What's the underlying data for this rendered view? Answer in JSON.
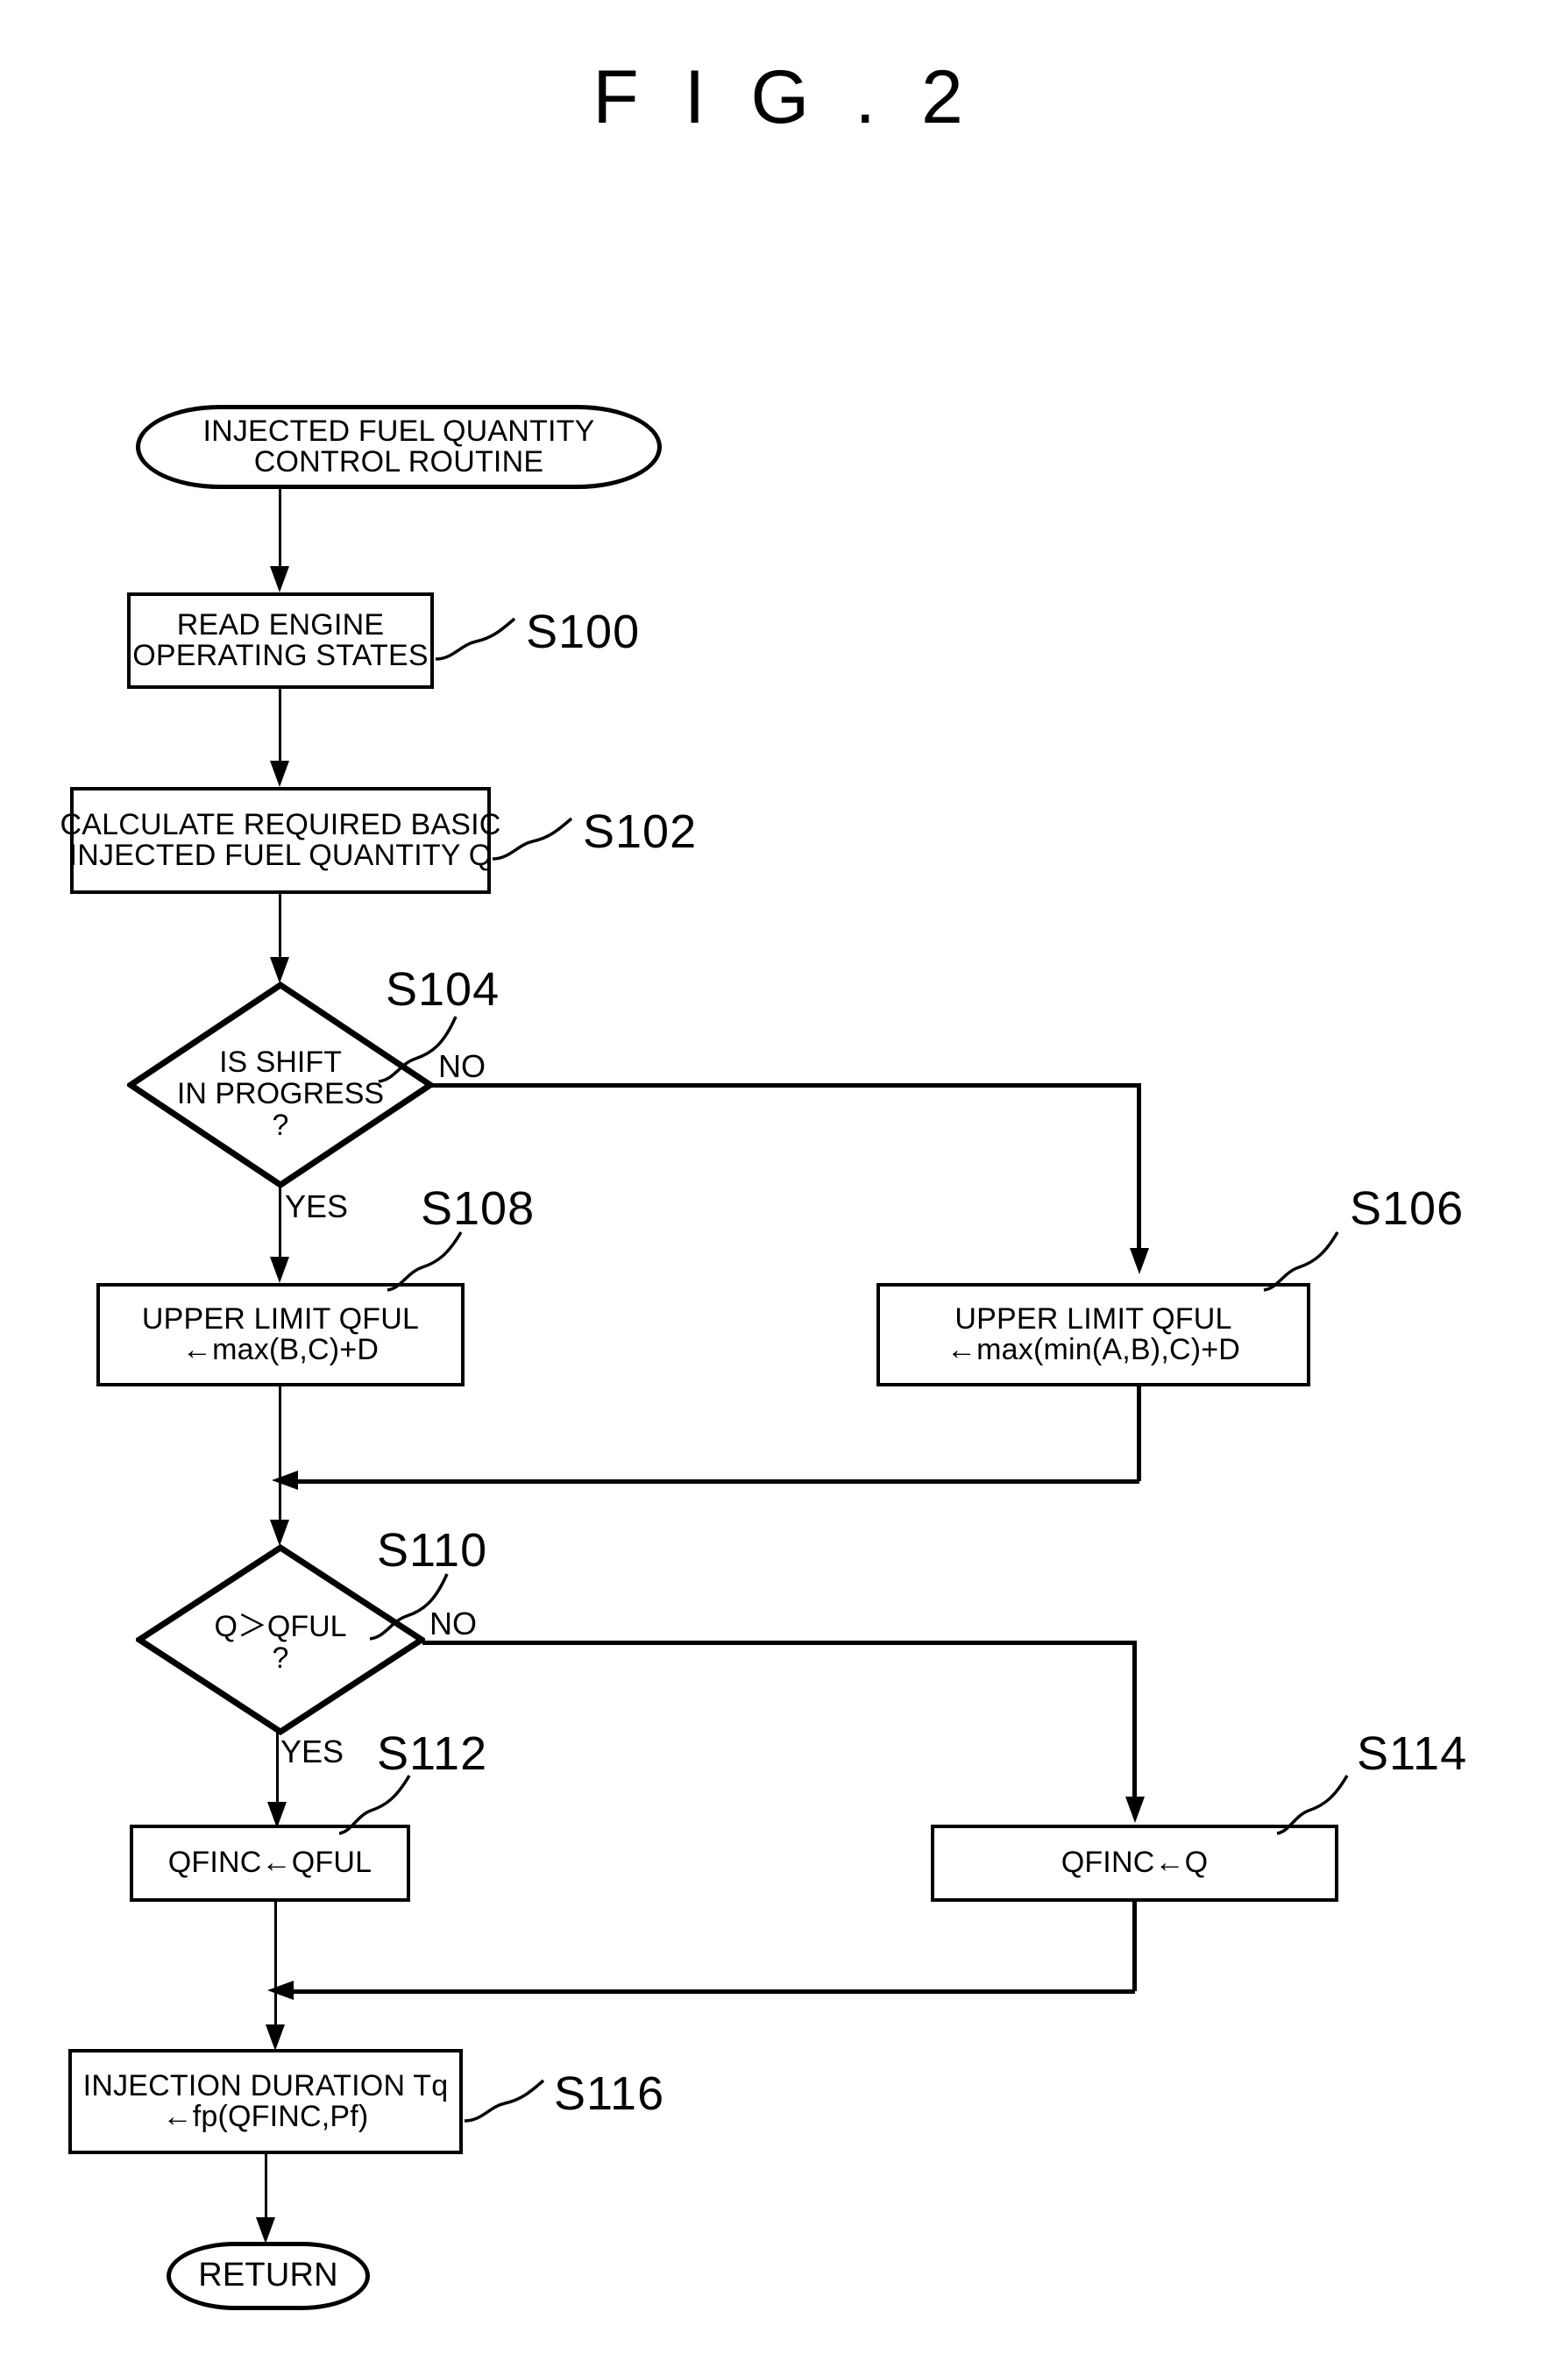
{
  "figure": {
    "title": "F I G . 2"
  },
  "flowchart": {
    "type": "flowchart",
    "orientation": "top-to-bottom",
    "nodes": [
      {
        "id": "start",
        "shape": "terminator",
        "step": "",
        "lines": [
          "INJECTED FUEL QUANTITY",
          "CONTROL ROUTINE"
        ]
      },
      {
        "id": "s100",
        "shape": "process",
        "step": "S100",
        "lines": [
          "READ ENGINE",
          "OPERATING STATES"
        ]
      },
      {
        "id": "s102",
        "shape": "process",
        "step": "S102",
        "lines": [
          "CALCULATE REQUIRED BASIC",
          "INJECTED FUEL QUANTITY Q"
        ]
      },
      {
        "id": "s104",
        "shape": "decision",
        "step": "S104",
        "lines": [
          "IS SHIFT",
          "IN PROGRESS",
          "?"
        ],
        "yes_label": "YES",
        "no_label": "NO"
      },
      {
        "id": "s108",
        "shape": "process",
        "step": "S108",
        "lines": [
          "UPPER LIMIT QFUL",
          "←max(B,C)+D"
        ]
      },
      {
        "id": "s106",
        "shape": "process",
        "step": "S106",
        "lines": [
          "UPPER LIMIT QFUL",
          "←max(min(A,B),C)+D"
        ]
      },
      {
        "id": "s110",
        "shape": "decision",
        "step": "S110",
        "lines": [
          "Q＞QFUL",
          "?"
        ],
        "yes_label": "YES",
        "no_label": "NO"
      },
      {
        "id": "s112",
        "shape": "process",
        "step": "S112",
        "lines": [
          "QFINC←QFUL"
        ]
      },
      {
        "id": "s114",
        "shape": "process",
        "step": "S114",
        "lines": [
          "QFINC←Q"
        ]
      },
      {
        "id": "s116",
        "shape": "process",
        "step": "S116",
        "lines": [
          "INJECTION DURATION Tq",
          "←fp(QFINC,Pf)"
        ]
      },
      {
        "id": "return",
        "shape": "terminator",
        "step": "",
        "lines": [
          "RETURN"
        ]
      }
    ],
    "edges": [
      {
        "from": "start",
        "to": "s100",
        "label": ""
      },
      {
        "from": "s100",
        "to": "s102",
        "label": ""
      },
      {
        "from": "s102",
        "to": "s104",
        "label": ""
      },
      {
        "from": "s104",
        "to": "s108",
        "label": "YES"
      },
      {
        "from": "s104",
        "to": "s106",
        "label": "NO"
      },
      {
        "from": "s108",
        "to": "s110",
        "label": ""
      },
      {
        "from": "s106",
        "to": "s110",
        "label": ""
      },
      {
        "from": "s110",
        "to": "s112",
        "label": "YES"
      },
      {
        "from": "s110",
        "to": "s114",
        "label": "NO"
      },
      {
        "from": "s112",
        "to": "s116",
        "label": ""
      },
      {
        "from": "s114",
        "to": "s116",
        "label": ""
      },
      {
        "from": "s116",
        "to": "return",
        "label": ""
      }
    ]
  },
  "colors": {
    "ink": "#000000",
    "paper": "#ffffff"
  }
}
